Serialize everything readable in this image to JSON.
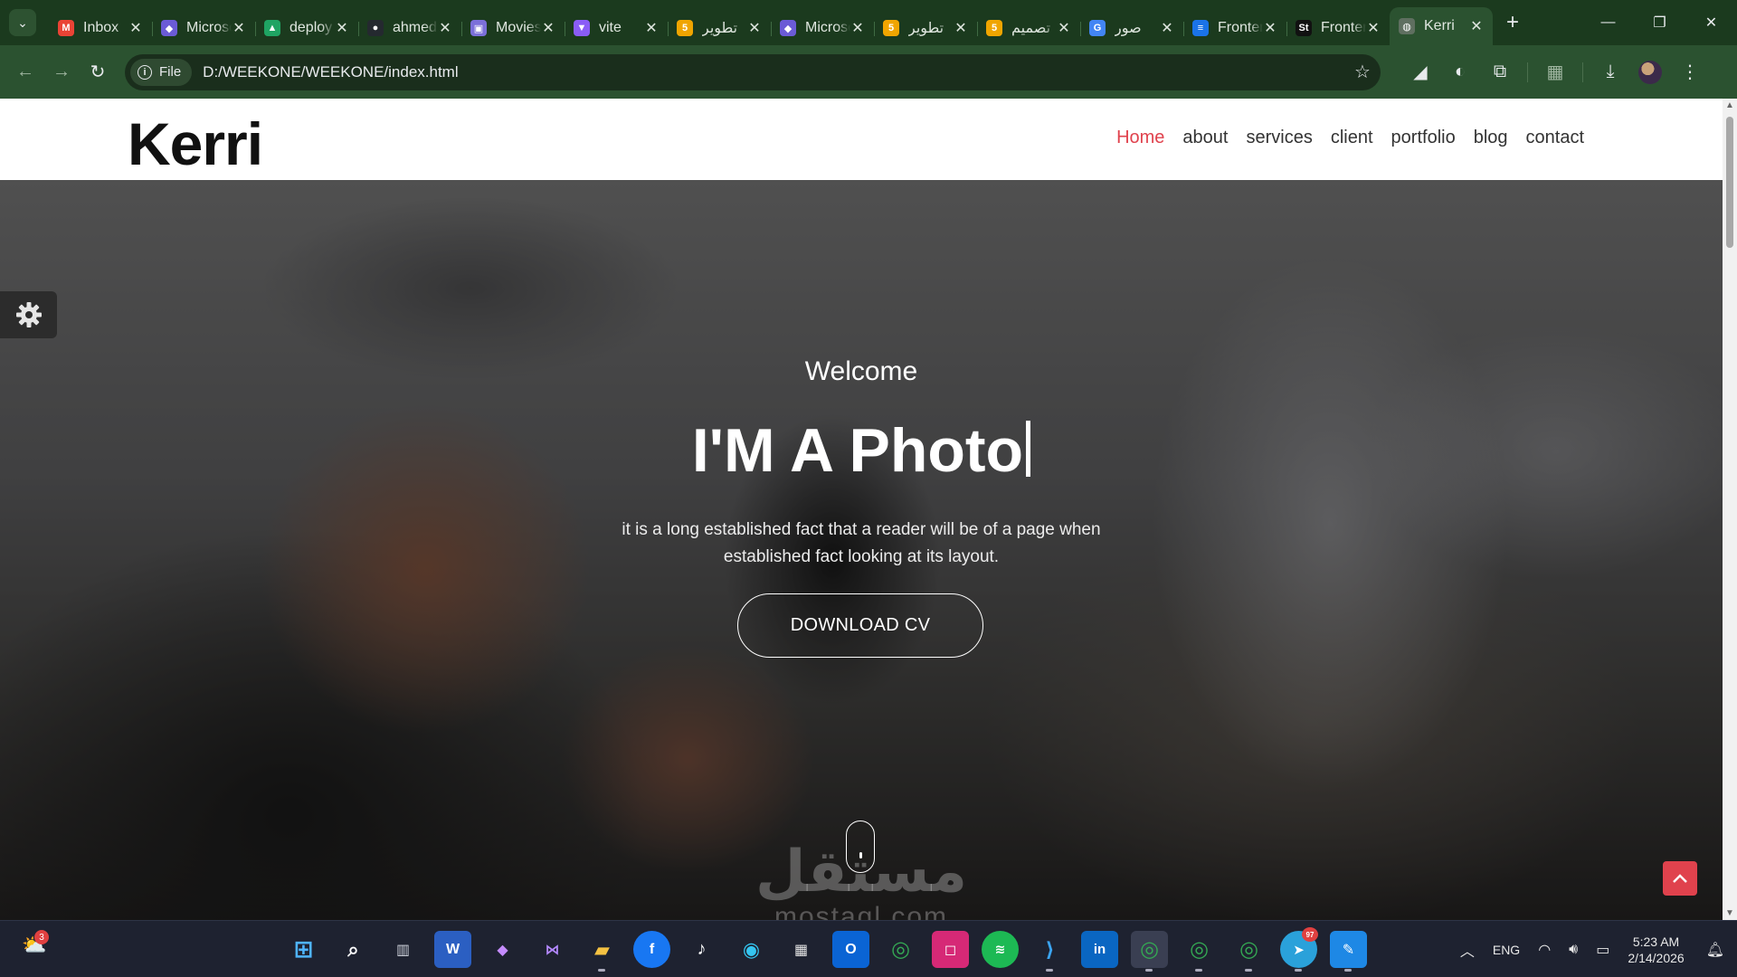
{
  "browser": {
    "tabs": [
      {
        "title": "Inbox",
        "icon": "gmail-icon",
        "color": "#ea4335",
        "glyph": "M"
      },
      {
        "title": "Microsoft Copilot",
        "icon": "copilot-icon",
        "color": "#6b5bd6",
        "glyph": "◆"
      },
      {
        "title": "deploy",
        "icon": "google-drive-icon",
        "color": "#1fa463",
        "glyph": "▲"
      },
      {
        "title": "ahmed",
        "icon": "github-icon",
        "color": "#24292f",
        "glyph": "●"
      },
      {
        "title": "Movies",
        "icon": "video-icon",
        "color": "#7b6fd9",
        "glyph": "▣"
      },
      {
        "title": "vite",
        "icon": "vite-icon",
        "color": "#8a5cf6",
        "glyph": "▼"
      },
      {
        "title": "تطوير",
        "icon": "mostaql-icon",
        "color": "#f0a500",
        "glyph": "5"
      },
      {
        "title": "Microsoft Copilot",
        "icon": "copilot-icon",
        "color": "#6b5bd6",
        "glyph": "◆"
      },
      {
        "title": "تطوير",
        "icon": "mostaql-icon",
        "color": "#f0a500",
        "glyph": "5"
      },
      {
        "title": "تصميم",
        "icon": "mostaql-icon",
        "color": "#f0a500",
        "glyph": "5"
      },
      {
        "title": "صور",
        "icon": "google-icon",
        "color": "#4285f4",
        "glyph": "G"
      },
      {
        "title": "Frontend",
        "icon": "forms-icon",
        "color": "#1a73e8",
        "glyph": "≡"
      },
      {
        "title": "Frontend",
        "icon": "site-icon",
        "color": "#111111",
        "glyph": "St"
      },
      {
        "title": "Kerri",
        "icon": "globe-icon",
        "color": "#5f6f60",
        "glyph": "◍",
        "active": true
      }
    ],
    "url_chip": "File",
    "url": "D:/WEEKONE/WEEKONE/index.html"
  },
  "site": {
    "logo": "Kerri",
    "nav": [
      "Home",
      "about",
      "services",
      "client",
      "portfolio",
      "blog",
      "contact"
    ],
    "active_nav": "Home",
    "hero": {
      "welcome": "Welcome",
      "title": "I'M A Photo",
      "description": "it is a long established fact that a reader will be of a page when established fact looking at its layout.",
      "cta": "DOWNLOAD CV"
    },
    "watermark": "مستقل",
    "watermark_sub": "mostaql.com",
    "accent": "#e0424d"
  },
  "taskbar": {
    "notification_count": "3",
    "telegram_badge": "97",
    "language": "ENG",
    "time": "5:23 AM",
    "date": "2/14/2026"
  }
}
